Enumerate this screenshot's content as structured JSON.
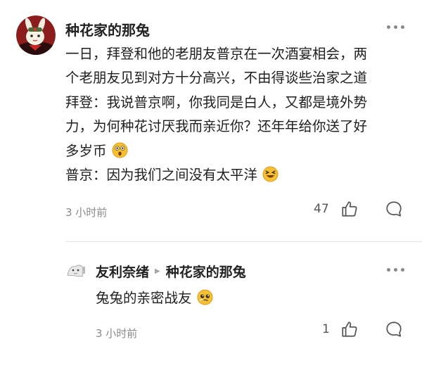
{
  "comment": {
    "author": "种花家的那兔",
    "lines": [
      "一日，拜登和他的老朋友普京在一次酒宴相会，两",
      "个老朋友见到对方十分高兴，不由得谈些治家之道",
      "拜登：我说普京啊，你我同是白人，又都是境外势",
      "力，为何种花讨厌我而亲近你？还年年给你送了好",
      "多岁币",
      "普京：因为我们之间没有太平洋"
    ],
    "time": "3 小时前",
    "likes": "47"
  },
  "reply": {
    "author": "友利奈绪",
    "reply_to": "种花家的那兔",
    "text": "兔兔的亲密战友",
    "time": "3 小时前",
    "likes": "1"
  },
  "colors": {
    "text": "#1f1f1f",
    "meta": "#8a8a8a",
    "avatar_bg": "#8b1d1d",
    "emoji": "#f6c033"
  }
}
